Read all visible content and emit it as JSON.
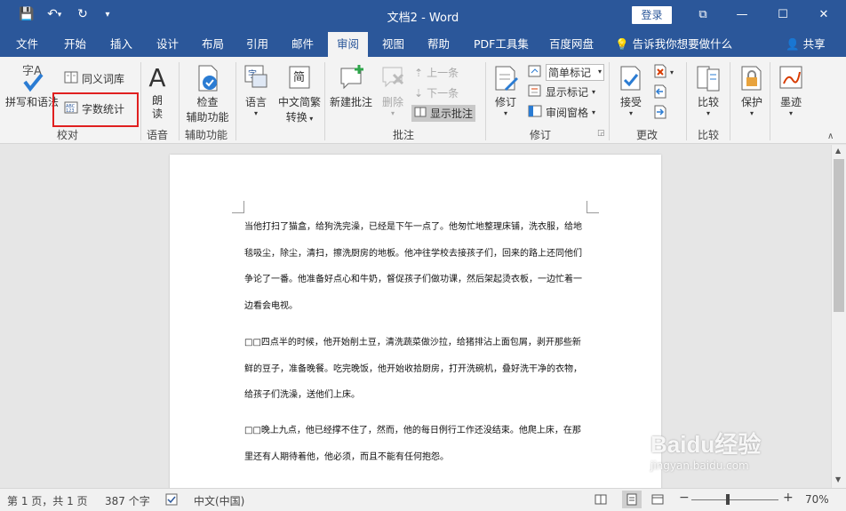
{
  "titlebar": {
    "title": "文档2 - Word",
    "login": "登录",
    "quick": {
      "save": "💾",
      "undo": "↶",
      "undo_arrow": "▾",
      "redo": "↻",
      "customize": "▾"
    },
    "window": {
      "restore": "⧉",
      "minimize": "—",
      "maximize": "☐",
      "close": "✕"
    }
  },
  "tabs": [
    "文件",
    "开始",
    "插入",
    "设计",
    "布局",
    "引用",
    "邮件",
    "审阅",
    "视图",
    "帮助",
    "PDF工具集",
    "百度网盘"
  ],
  "active_tab": "审阅",
  "tell_me": "告诉我你想要做什么",
  "share": "共享",
  "ribbon": {
    "proofing": {
      "spelling": "拼写和语法",
      "thesaurus": "同义词库",
      "word_count": "字数统计",
      "group": "校对"
    },
    "speech": {
      "read_aloud": "朗读",
      "read_aloud_top": "A",
      "group": "语音"
    },
    "accessibility": {
      "check_1": "检查",
      "check_2": "辅助功能",
      "group": "辅助功能"
    },
    "language": {
      "language": "语言",
      "convert_top": "简",
      "convert_1": "中文简繁",
      "convert_2": "转换"
    },
    "comments": {
      "new": "新建批注",
      "delete": "删除",
      "prev": "上一条",
      "next": "下一条",
      "show": "显示批注",
      "group": "批注"
    },
    "tracking": {
      "track": "修订",
      "markup": "简单标记",
      "show_markup": "显示标记",
      "pane": "审阅窗格",
      "group": "修订"
    },
    "changes": {
      "accept": "接受",
      "group": "更改"
    },
    "compare": {
      "compare": "比较",
      "group": "比较"
    },
    "protect": {
      "protect": "保护"
    },
    "ink": {
      "ink": "墨迹"
    }
  },
  "document": {
    "paragraphs": [
      "当他打扫了猫盒，给狗洗完澡，已经是下午一点了。他匆忙地整理床铺，洗衣服，给地毯吸尘，除尘，清扫，擦洗厨房的地板。他冲往学校去接孩子们，回来的路上还同他们争论了一番。他准备好点心和牛奶，督促孩子们做功课，然后架起烫衣板，一边忙着一边看会电视。",
      "□□四点半的时候，他开始削土豆，清洗蔬菜做沙拉，给猪排沾上面包屑，剥开那些新鲜的豆子，准备晚餐。吃完晚饭，他开始收拾厨房，打开洗碗机，叠好洗干净的衣物，给孩子们洗澡，送他们上床。",
      "□□晚上九点，他已经撑不住了，然而，他的每日例行工作还没结束。他爬上床，在那里还有人期待着他，他必须，而且不能有任何抱怨。"
    ]
  },
  "status": {
    "page": "第 1 页，共 1 页",
    "words": "387 个字",
    "language": "中文(中国)",
    "zoom": "70%"
  },
  "watermark": {
    "brand": "Baidu经验",
    "url": "jingyan.baidu.com"
  },
  "colors": {
    "brand": "#2b579a",
    "highlight": "#e02020"
  }
}
